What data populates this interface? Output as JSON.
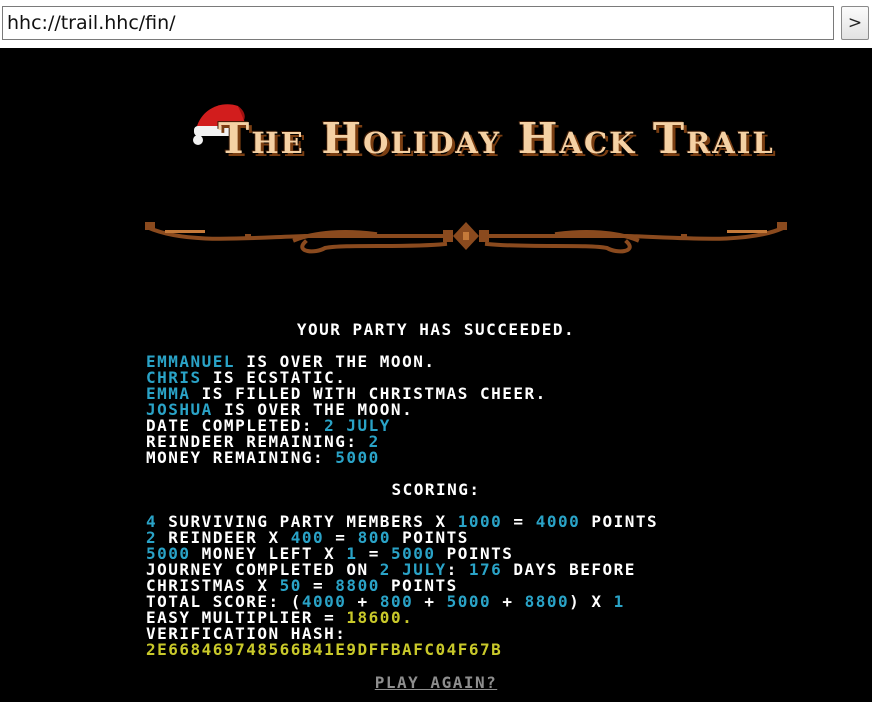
{
  "browser": {
    "url": "hhc://trail.hhc/fin/",
    "go_label": ">"
  },
  "game": {
    "title": "The Holiday Hack Trail",
    "heading": "Your party has succeeded.",
    "party": [
      {
        "name": "Emmanuel",
        "status": "is over the moon."
      },
      {
        "name": "Chris",
        "status": "is ecstatic."
      },
      {
        "name": "Emma",
        "status": "is filled with christmas cheer."
      },
      {
        "name": "Joshua",
        "status": "is over the moon."
      }
    ],
    "date_completed_label": "Date completed:",
    "date_completed": "2 July",
    "reindeer_label": "Reindeer remaining:",
    "reindeer": "2",
    "money_label": "Money remaining:",
    "money": "5000",
    "scoring_label": "Scoring:",
    "score_lines": {
      "members_count": "4",
      "members_text": "surviving party members x",
      "members_mult": "1000",
      "members_pts": "4000",
      "reindeer_count": "2",
      "reindeer_text": "reindeer x",
      "reindeer_mult": "400",
      "reindeer_pts": "800",
      "money_amt": "5000",
      "money_text": "money left x",
      "money_mult": "1",
      "money_pts": "5000",
      "journey_text": "journey completed on",
      "journey_date": "2 July",
      "journey_days": "176",
      "journey_text2": "days before",
      "christmas_text": "christmas x",
      "christmas_mult": "50",
      "christmas_pts": "8800",
      "total_label": "total score: (",
      "total_a": "4000",
      "total_b": "800",
      "total_c": "5000",
      "total_d": "8800",
      "total_mult": "1",
      "easy_label": "easy multiplier =",
      "easy_value": "18600.",
      "hash_label": "verification hash:",
      "hash": "2E668469748566B41E9DFFBAFC04F67B"
    },
    "play_again": "Play again?",
    "points_word": "points",
    "equals": "=",
    "plus": "+",
    "paren_close": ") x"
  },
  "colors": {
    "background": "#000000",
    "text": "#ffffff",
    "highlight": "#2aa3c7",
    "hash": "#c9c92a",
    "title": "#f5d1a4",
    "divider": "#8a4a1e"
  }
}
